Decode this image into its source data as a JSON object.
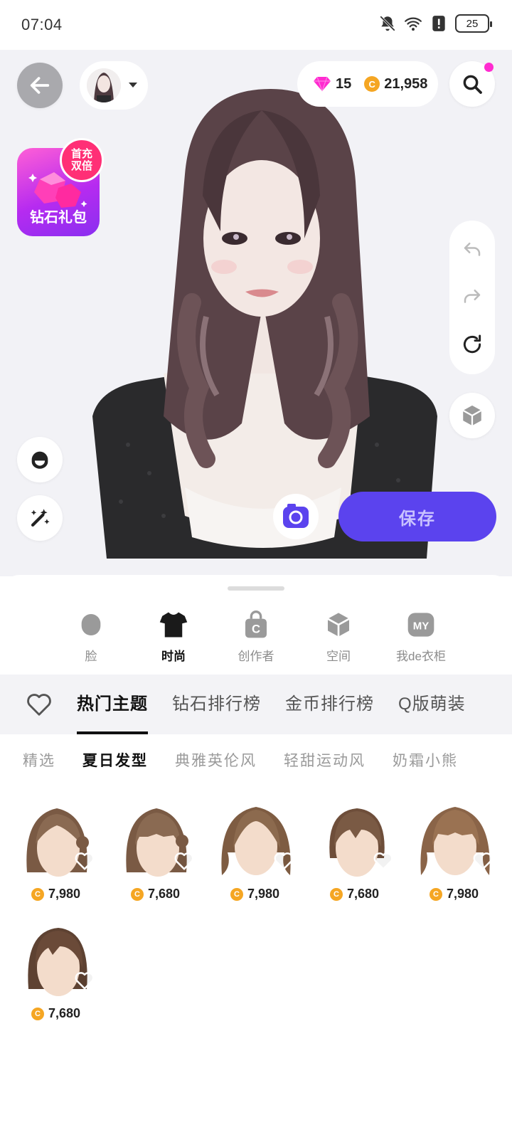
{
  "status_bar": {
    "time": "07:04",
    "battery": "25"
  },
  "currency": {
    "diamonds": "15",
    "coins": "21,958"
  },
  "gift": {
    "badge": "首充\n双倍",
    "label": "钻石礼包"
  },
  "save_label": "保存",
  "categories": [
    {
      "label": "脸",
      "icon": "face-icon",
      "active": false
    },
    {
      "label": "时尚",
      "icon": "tshirt-icon",
      "active": true
    },
    {
      "label": "创作者",
      "icon": "creator-bag-icon",
      "active": false
    },
    {
      "label": "空间",
      "icon": "space-cube-icon",
      "active": false
    },
    {
      "label": "我de衣柜",
      "icon": "my-wardrobe-icon",
      "active": false
    }
  ],
  "theme_tabs": [
    "热门主题",
    "钻石排行榜",
    "金币排行榜",
    "Q版萌装"
  ],
  "sub_tabs": [
    "精选",
    "夏日发型",
    "典雅英伦风",
    "轻甜运动风",
    "奶霜小熊"
  ],
  "items": [
    {
      "price": "7,980"
    },
    {
      "price": "7,680"
    },
    {
      "price": "7,980"
    },
    {
      "price": "7,680"
    },
    {
      "price": "7,980"
    },
    {
      "price": "7,680"
    }
  ],
  "colors": {
    "accent": "#5b43ee",
    "coin": "#f5a623",
    "diamond": "#ff2bd0"
  }
}
